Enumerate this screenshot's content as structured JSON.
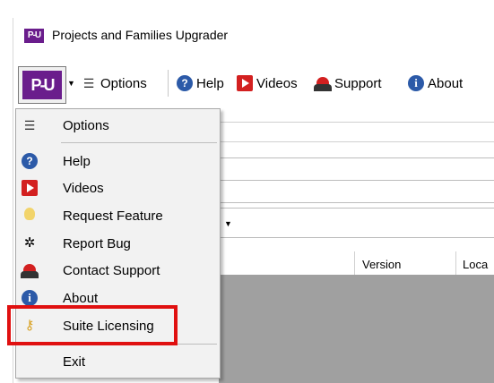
{
  "window": {
    "title": "Projects and Families Upgrader",
    "app_icon_text": "P-U",
    "logo_text": "P-U"
  },
  "toolbar": {
    "options_label": "Options",
    "help_label": "Help",
    "videos_label": "Videos",
    "support_label": "Support",
    "about_label": "About"
  },
  "grid": {
    "columns": [
      "Version",
      "Loca"
    ]
  },
  "menu": {
    "items": [
      {
        "label": "Options",
        "icon": "list-icon"
      },
      {
        "label": "Help",
        "icon": "help-icon"
      },
      {
        "label": "Videos",
        "icon": "video-icon"
      },
      {
        "label": "Request Feature",
        "icon": "lightbulb-icon"
      },
      {
        "label": "Report Bug",
        "icon": "bug-icon"
      },
      {
        "label": "Contact Support",
        "icon": "support-icon"
      },
      {
        "label": "About",
        "icon": "about-icon"
      },
      {
        "label": "Suite Licensing",
        "icon": "key-icon"
      },
      {
        "label": "Exit",
        "icon": ""
      }
    ]
  },
  "colors": {
    "brand_purple": "#6a1d8c",
    "highlight_red": "#e01010",
    "icon_blue": "#2c5aa8",
    "icon_red": "#d32020",
    "grid_gray": "#a0a0a0"
  }
}
